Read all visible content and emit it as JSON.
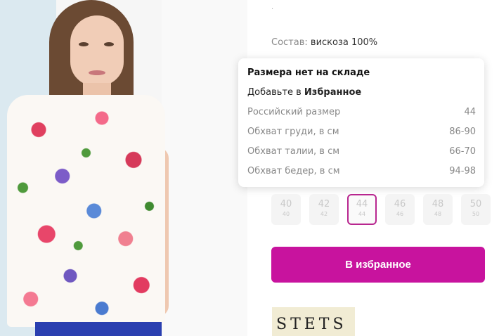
{
  "composition": {
    "label": "Состав:",
    "value": "вискоза 100%"
  },
  "top_marker": "·",
  "tooltip": {
    "heading": "Размера нет на складе",
    "fav_prefix": "Добавьте в",
    "fav_bold": "Избранное",
    "rows": [
      {
        "label": "Российский размер",
        "value": "44"
      },
      {
        "label": "Обхват груди, в см",
        "value": "86-90"
      },
      {
        "label": "Обхват талии, в см",
        "value": "66-70"
      },
      {
        "label": "Обхват бедер, в см",
        "value": "94-98"
      }
    ]
  },
  "sizes": [
    {
      "main": "40",
      "sub": "40",
      "selected": false
    },
    {
      "main": "42",
      "sub": "42",
      "selected": false
    },
    {
      "main": "44",
      "sub": "44",
      "selected": true
    },
    {
      "main": "46",
      "sub": "46",
      "selected": false
    },
    {
      "main": "48",
      "sub": "48",
      "selected": false
    },
    {
      "main": "50",
      "sub": "50",
      "selected": false
    }
  ],
  "favorite_button": "В избранное",
  "brand_logo": "STETS",
  "colors": {
    "accent": "#c8139e",
    "selected_border": "#b8268f"
  }
}
